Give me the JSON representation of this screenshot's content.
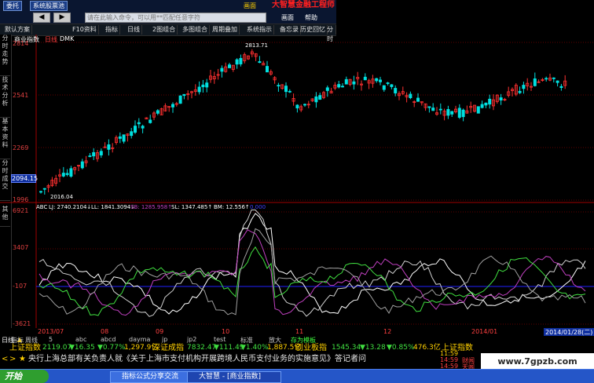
{
  "topbar": {
    "btn1": "委托",
    "btn2": "系统股票池",
    "brand": "大智慧金融工程师",
    "menu": [
      "画面",
      "帮助"
    ]
  },
  "command": {
    "placeholder": "请在此输入命令，可以用**匹配任意字符"
  },
  "toolbar": {
    "items": [
      "默认方案",
      "F10资料",
      "指标",
      "日线",
      "2图组合",
      "多图组合",
      "周期叠加",
      "系统指示",
      "备忘录",
      "历史回忆",
      "分时"
    ]
  },
  "lefttabs": [
    "分时走势",
    "技术分析",
    "基本资料",
    "分时成交",
    "其他"
  ],
  "main_chart": {
    "name": "商业指数",
    "period": "日线",
    "indicator": "DMK",
    "y_ticks": [
      "2814",
      "2541",
      "2269",
      "1996"
    ],
    "current_price": "2094.15",
    "high_label": "2813.71",
    "low_label": "2016.04"
  },
  "sub_chart": {
    "name": "ABC",
    "legend": [
      {
        "text": "LJ: 2740.2104↓",
        "color": "#ffffff"
      },
      {
        "text": "LL: 1841.3094↓",
        "color": "#ffffff"
      },
      {
        "text": "SB: 1285.958↑",
        "color": "#c040c0"
      },
      {
        "text": "SL: 1347.485↑",
        "color": "#ffffff"
      },
      {
        "text": "BM: 12.556↑",
        "color": "#ffffff"
      },
      {
        "text": "0.000",
        "color": "#4040ff"
      }
    ],
    "y_ticks": [
      "6921",
      "3407",
      "-107",
      "-3621"
    ]
  },
  "time_axis": {
    "labels": [
      "2013/07",
      "08",
      "09",
      "10",
      "11",
      "12",
      "2014/01"
    ],
    "current_date": "2014/01/28(二)"
  },
  "bottom_tabs": [
    "日线",
    "指标",
    "周线",
    "5",
    "abc",
    "abcd",
    "dayma",
    "jp",
    "jp2",
    "test",
    "标准",
    "放大",
    "存为模板"
  ],
  "index_row": {
    "sh_name": "上证指数",
    "sh_value": "2119.07",
    "sh_change": "▼16.35",
    "sh_pct": "▼0.77%",
    "sh_amount": "1,297.9亿",
    "sz_name": "深证成指",
    "sz_value": "7832.47",
    "sz_change": "▼111.49",
    "sz_pct": "▼1.40%",
    "sz_amount": "1,887.5亿",
    "cy_name": "创业板指",
    "cy_value": "1545.34",
    "cy_change": "▼13.28",
    "cy_pct": "▼0.85%",
    "cy_amount": "476.3亿",
    "sh_name2": "上证指数"
  },
  "news": {
    "text": "央行上海总部有关负责人就《关于上海市支付机构开展跨境人民币支付业务的实施意见》答记者问",
    "time1": "11:59",
    "time2": "14:59",
    "time3": "14:59",
    "tag1": "财闻",
    "tag2": "天闻"
  },
  "watermark": "www.7gpzb.com",
  "taskbar": {
    "start": "开始",
    "task1": "指标公式分享交流",
    "task2": "大智慧 - [商业指数]"
  },
  "colors": {
    "up": "#ff3030",
    "down": "#00e0e0",
    "axis": "#e04040",
    "grid_red": "#a00000"
  }
}
